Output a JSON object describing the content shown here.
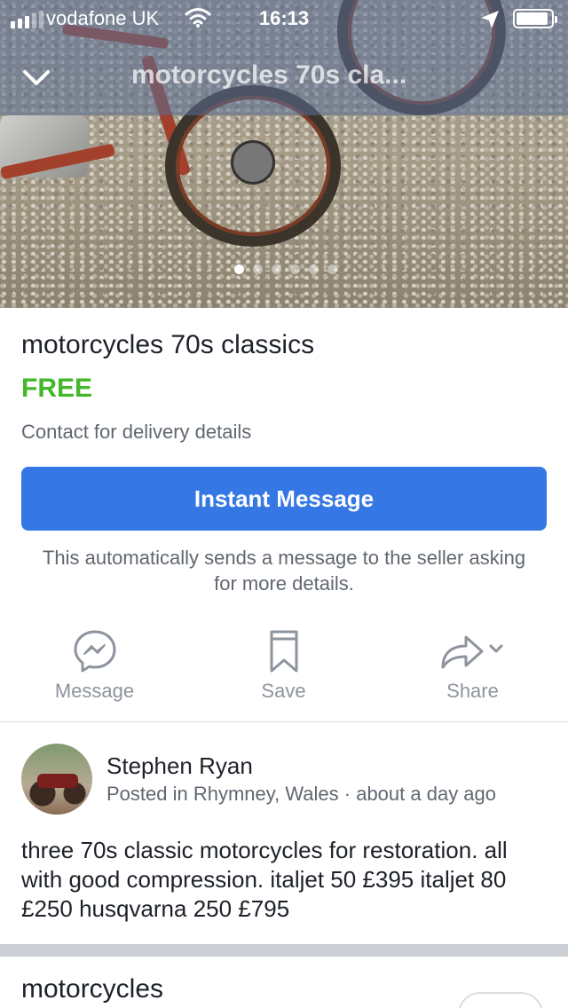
{
  "status_bar": {
    "carrier": "vodafone UK",
    "time": "16:13"
  },
  "nav": {
    "title": "motorcycles 70s cla..."
  },
  "gallery": {
    "photo_count": 6,
    "active_index": 0
  },
  "listing": {
    "title": "motorcycles 70s classics",
    "price": "FREE",
    "delivery_note": "Contact for delivery details",
    "primary_button_label": "Instant Message",
    "helper_text": "This automatically sends a message to the seller asking for more details."
  },
  "actions": {
    "message_label": "Message",
    "save_label": "Save",
    "share_label": "Share"
  },
  "seller": {
    "name": "Stephen Ryan",
    "meta": "Posted in Rhymney, Wales · about a day ago"
  },
  "description": "three 70s classic motorcycles  for restoration. all with good compression. italjet 50 £395 italjet 80 £250 husqvarna 250 £795",
  "next_section": {
    "title": "motorcycles"
  },
  "colors": {
    "price_green": "#42b72a",
    "primary_blue": "#3578e5",
    "secondary_text": "#606770",
    "action_grey": "#8d949e",
    "separator": "#ccd0d5"
  }
}
